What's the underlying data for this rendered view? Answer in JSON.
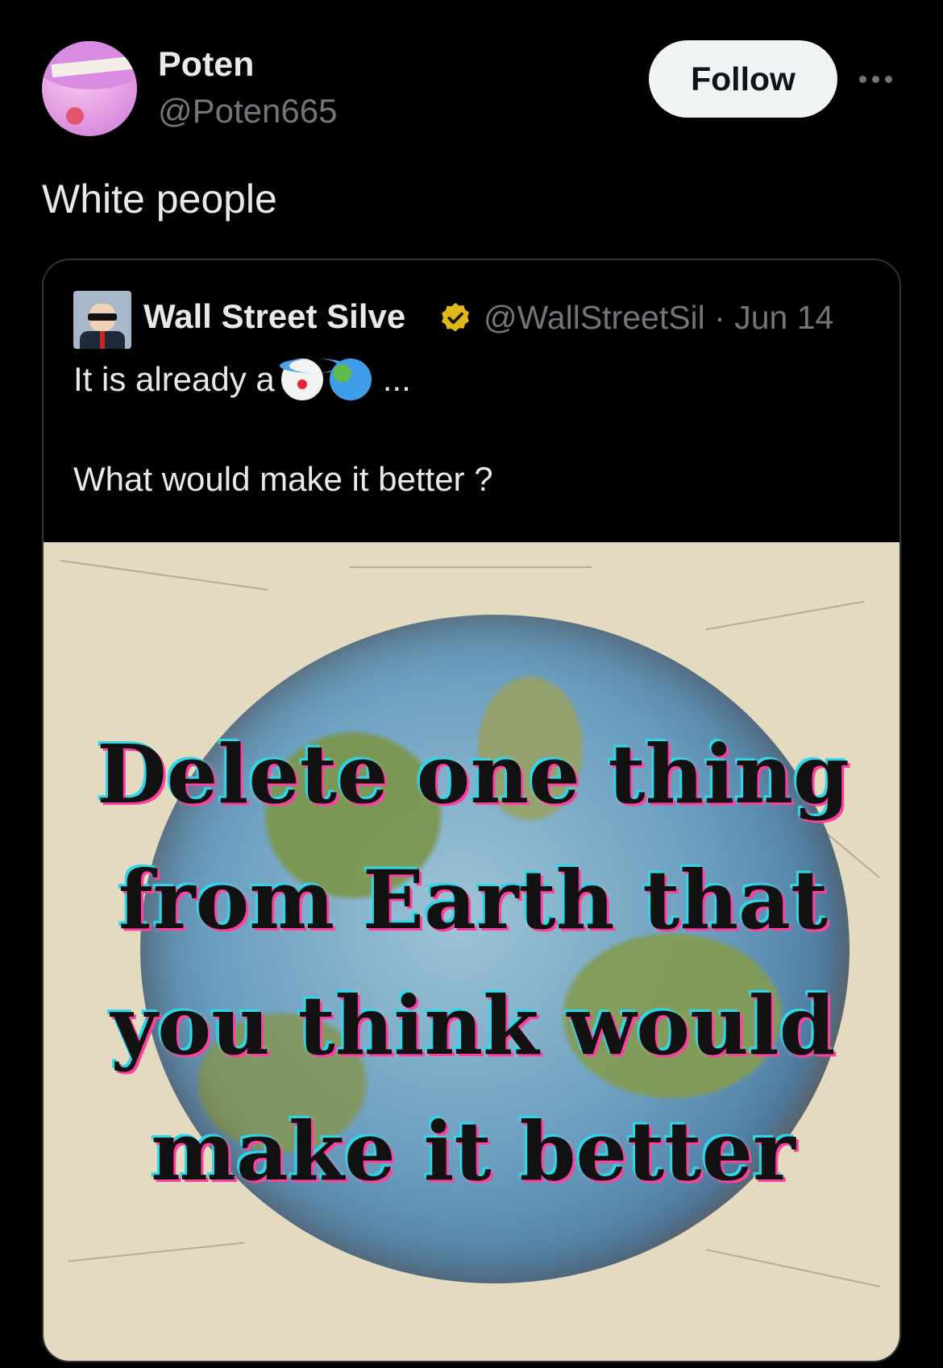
{
  "post": {
    "author_name": "Poten",
    "author_handle": "@Poten665",
    "follow_label": "Follow",
    "text": "White people"
  },
  "quote": {
    "author_name": "Wall Street Silve",
    "meta": "@WallStreetSil · Jun 14",
    "line1_text": "It is already a",
    "line1_emojis": [
      "clown-face",
      "globe"
    ],
    "line1_suffix": "...",
    "line2_text": "What would make it better ?",
    "image_text_lines": [
      "Delete one thing",
      "from Earth that",
      "you think would",
      "make it better"
    ]
  },
  "colors": {
    "background": "#000000",
    "text_primary": "#e7e9ea",
    "text_secondary": "#71767b",
    "follow_bg": "#eff3f4",
    "verified_gold": "#e2b719"
  }
}
